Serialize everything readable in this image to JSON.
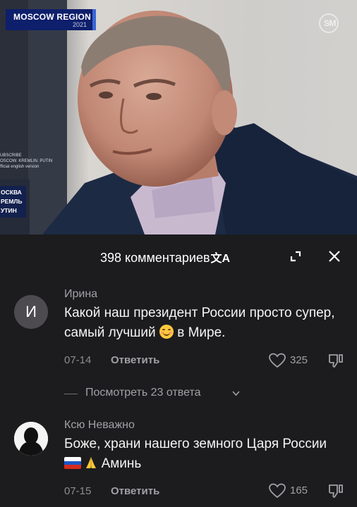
{
  "video": {
    "region_badge": {
      "line1": "MOSCOW REGION",
      "line2": "2021"
    },
    "channel_logo": {
      "text": "SM",
      "icon": "channel-logo-icon"
    },
    "subtitle_lines": [
      "UBSCRIBE",
      "OSCOW. KREMLIN. PUTIN",
      "fficial english version"
    ],
    "channel_badge": [
      "ОСКВА",
      "РЕМЛЬ",
      "УТИН"
    ]
  },
  "comments_panel": {
    "title": "398 комментариев",
    "translate_icon": "文A",
    "expand_icon": "expand-icon",
    "close_icon": "close-icon",
    "comments": [
      {
        "avatar_letter": "И",
        "author": "Ирина",
        "text_part1": "Какой наш президент России просто супер, самый лучший",
        "text_part2": "в Мире.",
        "date": "07-14",
        "reply_label": "Ответить",
        "likes": "325"
      },
      {
        "author": "Ксю Неважно",
        "text_part1": "Боже, храни нашего земного Царя России",
        "text_part2": "Аминь",
        "date": "07-15",
        "reply_label": "Ответить",
        "likes": "165"
      }
    ],
    "view_replies": "Посмотреть 23 ответа"
  },
  "colors": {
    "panel_bg": "#1c1c1e",
    "muted_text": "#a1a1a6",
    "badge_blue": "#0e1f6b"
  }
}
